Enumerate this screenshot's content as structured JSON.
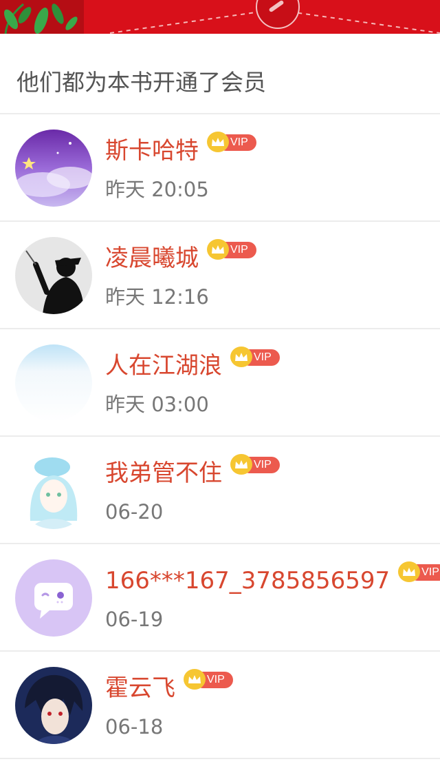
{
  "section": {
    "title": "他们都为本书开通了会员"
  },
  "vip_label": "VIP",
  "colors": {
    "banner_red": "#d8101a",
    "name_red": "#d8472f",
    "vip_pill": "#ec5a4e",
    "crown_gold": "#f6c632"
  },
  "members": [
    {
      "name": "斯卡哈特",
      "time": "昨天 20:05",
      "avatar": "galaxy-avatar"
    },
    {
      "name": "凌晨曦城",
      "time": "昨天 12:16",
      "avatar": "silhouette-smoker-avatar"
    },
    {
      "name": "人在江湖浪",
      "time": "昨天 03:00",
      "avatar": "sky-blur-avatar"
    },
    {
      "name": "我弟管不住",
      "time": "06-20",
      "avatar": "anime-girl-avatar"
    },
    {
      "name": "166***167_3785856597",
      "time": "06-19",
      "avatar": "default-chat-avatar"
    },
    {
      "name": "霍云飞",
      "time": "06-18",
      "avatar": "anime-ninja-avatar"
    }
  ]
}
